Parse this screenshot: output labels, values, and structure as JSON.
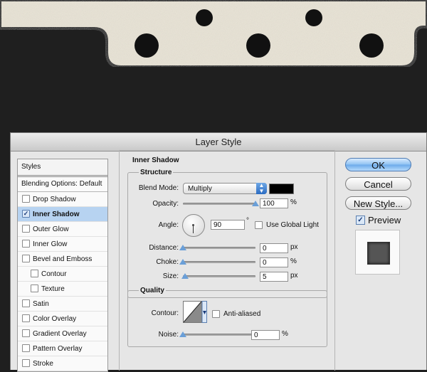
{
  "dialog": {
    "title": "Layer Style"
  },
  "styles_list": {
    "header": "Styles",
    "blending_options": "Blending Options: Default",
    "items": [
      {
        "label": "Drop Shadow",
        "checked": false,
        "selected": false,
        "sub": false
      },
      {
        "label": "Inner Shadow",
        "checked": true,
        "selected": true,
        "sub": false
      },
      {
        "label": "Outer Glow",
        "checked": false,
        "selected": false,
        "sub": false
      },
      {
        "label": "Inner Glow",
        "checked": false,
        "selected": false,
        "sub": false
      },
      {
        "label": "Bevel and Emboss",
        "checked": false,
        "selected": false,
        "sub": false
      },
      {
        "label": "Contour",
        "checked": false,
        "selected": false,
        "sub": true
      },
      {
        "label": "Texture",
        "checked": false,
        "selected": false,
        "sub": true
      },
      {
        "label": "Satin",
        "checked": false,
        "selected": false,
        "sub": false
      },
      {
        "label": "Color Overlay",
        "checked": false,
        "selected": false,
        "sub": false
      },
      {
        "label": "Gradient Overlay",
        "checked": false,
        "selected": false,
        "sub": false
      },
      {
        "label": "Pattern Overlay",
        "checked": false,
        "selected": false,
        "sub": false
      },
      {
        "label": "Stroke",
        "checked": false,
        "selected": false,
        "sub": false
      }
    ]
  },
  "panel": {
    "title": "Inner Shadow",
    "structure": {
      "title": "Structure",
      "blend_mode_label": "Blend Mode:",
      "blend_mode_value": "Multiply",
      "blend_color": "#000000",
      "opacity_label": "Opacity:",
      "opacity_value": "100",
      "opacity_unit": "%",
      "opacity_level": 1.0,
      "angle_label": "Angle:",
      "angle_value": "90",
      "angle_unit": "°",
      "global_light_label": "Use Global Light",
      "global_light_checked": false,
      "distance_label": "Distance:",
      "distance_value": "0",
      "distance_unit": "px",
      "distance_level": 0.0,
      "choke_label": "Choke:",
      "choke_value": "0",
      "choke_unit": "%",
      "choke_level": 0.0,
      "size_label": "Size:",
      "size_value": "5",
      "size_unit": "px",
      "size_level": 0.03
    },
    "quality": {
      "title": "Quality",
      "contour_label": "Contour:",
      "antialiased_label": "Anti-aliased",
      "antialiased_checked": false,
      "noise_label": "Noise:",
      "noise_value": "0",
      "noise_unit": "%",
      "noise_level": 0.0
    }
  },
  "buttons": {
    "ok": "OK",
    "cancel": "Cancel",
    "new_style": "New Style..."
  },
  "preview": {
    "label": "Preview",
    "checked": true
  },
  "colors": {
    "accent": "#6aa9ea",
    "selection": "#b7d3f1",
    "background": "#1f1f1f",
    "paper": "#e9e4d6"
  }
}
